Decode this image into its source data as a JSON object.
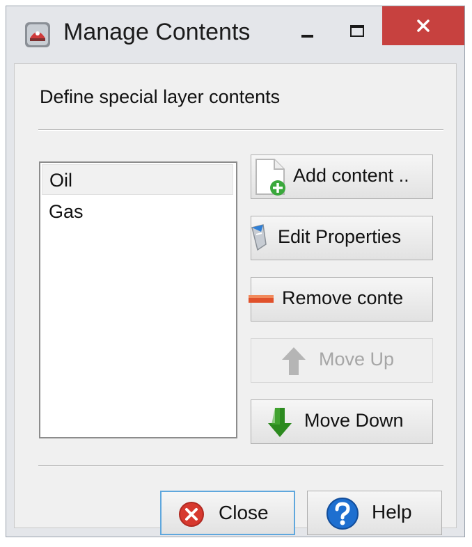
{
  "window": {
    "title": "Manage Contents",
    "icon": "app-icon",
    "controls": [
      "minimize-icon",
      "maximize-icon",
      "close-icon"
    ],
    "close_color": "#c7413f"
  },
  "header": {
    "label": "Define special layer contents"
  },
  "contents_list": {
    "items": [
      "Oil",
      "Gas"
    ],
    "selected": "Oil"
  },
  "actions": {
    "add": "Add content ..",
    "edit": "Edit Properties",
    "remove": "Remove conte",
    "move_up": "Move Up",
    "move_down": "Move Down"
  },
  "footer": {
    "close": "Close",
    "help": "Help"
  },
  "colors": {
    "add_icon": "#3aa83c",
    "remove_icon": "#e0512b",
    "move_down_icon": "#2c8a1f",
    "close_icon": "#d7392f",
    "help_icon": "#1e6fd0",
    "focus_border": "#5fa7dd"
  }
}
